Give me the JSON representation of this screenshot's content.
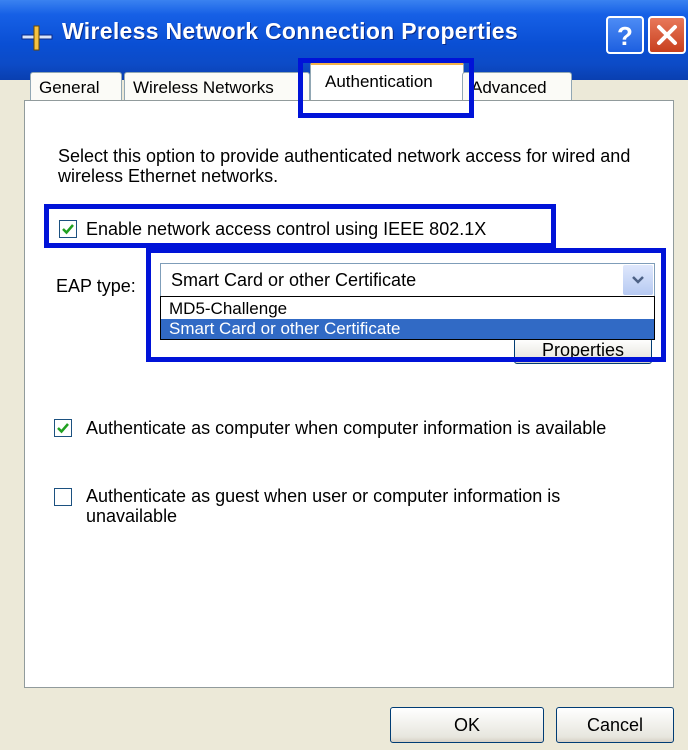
{
  "window": {
    "title": "Wireless Network Connection Properties",
    "icons": {
      "app": "network-connection-icon",
      "help": "help-icon",
      "close": "close-icon"
    }
  },
  "tabs": [
    {
      "label": "General",
      "active": false
    },
    {
      "label": "Wireless Networks",
      "active": false
    },
    {
      "label": "Authentication",
      "active": true
    },
    {
      "label": "Advanced",
      "active": false
    }
  ],
  "auth": {
    "description": "Select this option to provide authenticated network access for wired and wireless Ethernet networks.",
    "enable_8021x": {
      "label": "Enable network access control using IEEE 802.1X",
      "checked": true
    },
    "eap_type_label": "EAP type:",
    "eap_selected": "Smart Card or other Certificate",
    "eap_options": [
      "MD5-Challenge",
      "Smart Card or other Certificate"
    ],
    "eap_highlighted_index": 1,
    "properties_button": "Properties",
    "auth_as_computer": {
      "label": "Authenticate as computer when computer information is available",
      "checked": true
    },
    "auth_as_guest": {
      "label": "Authenticate as guest when user or computer information is unavailable",
      "checked": false
    }
  },
  "footer": {
    "ok": "OK",
    "cancel": "Cancel"
  },
  "colors": {
    "highlight_box": "#0013d8",
    "selection": "#316ac5",
    "titlebar": "#0a4fd4"
  }
}
